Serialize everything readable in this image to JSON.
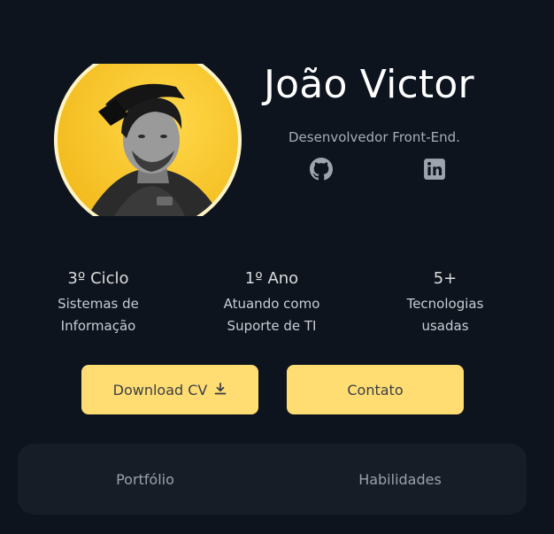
{
  "profile": {
    "name": "João Victor",
    "role": "Desenvolvedor Front-End.",
    "avatar_icon": "profile-photo",
    "accent": "#ffdd73"
  },
  "social": {
    "github_icon": "github-icon",
    "linkedin_icon": "linkedin-icon"
  },
  "stats": [
    {
      "value": "3º Ciclo",
      "label_line1": "Sistemas de",
      "label_line2": "Informação"
    },
    {
      "value": "1º Ano",
      "label_line1": "Atuando como",
      "label_line2": "Suporte de TI"
    },
    {
      "value": "5+",
      "label_line1": "Tecnologias",
      "label_line2": "usadas"
    }
  ],
  "buttons": {
    "download_cv": "Download CV",
    "download_icon": "download-icon",
    "contact": "Contato"
  },
  "tabs": [
    {
      "label": "Portfólio"
    },
    {
      "label": "Habilidades"
    }
  ],
  "colors": {
    "background": "#0d141e",
    "panel": "#161d27",
    "button": "#ffdd73"
  }
}
